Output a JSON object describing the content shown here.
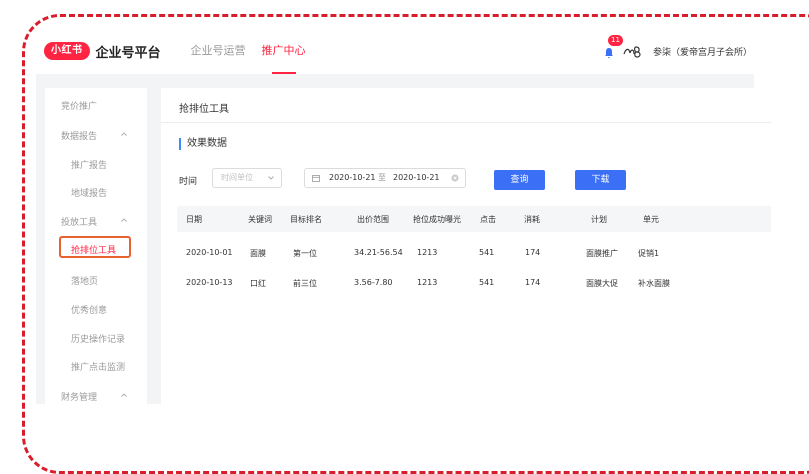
{
  "brand": {
    "badge": "小红书",
    "platform": "企业号平台"
  },
  "nav": {
    "tabs": [
      {
        "label": "企业号运营",
        "active": false
      },
      {
        "label": "推广中心",
        "active": true
      }
    ]
  },
  "top_right": {
    "notification_count": "11",
    "user": "参柒（爱帝宫月子会所）"
  },
  "sidebar": {
    "items": [
      {
        "label": "竞价推广"
      },
      {
        "label": "数据报告"
      },
      {
        "label": "推广报告"
      },
      {
        "label": "地域报告"
      },
      {
        "label": "投放工具"
      },
      {
        "label": "抢排位工具"
      },
      {
        "label": "落地页"
      },
      {
        "label": "优秀创意"
      },
      {
        "label": "历史操作记录"
      },
      {
        "label": "推广点击监测"
      },
      {
        "label": "财务管理"
      }
    ]
  },
  "main": {
    "page_title": "抢排位工具",
    "section_title": "效果数据",
    "filter": {
      "time_label": "时间",
      "unit_placeholder": "时间单位",
      "date_start": "2020-10-21",
      "date_sep": "至",
      "date_end": "2020-10-21",
      "query_button": "查询",
      "download_button": "下载"
    },
    "table": {
      "columns": [
        "日期",
        "关键词",
        "目标排名",
        "出价范围",
        "抢位成功曝光",
        "点击",
        "消耗",
        "计划",
        "单元"
      ],
      "rows": [
        [
          "2020-10-01",
          "面膜",
          "第一位",
          "34.21-56.54",
          "1213",
          "541",
          "174",
          "面膜推广",
          "促销1"
        ],
        [
          "2020-10-13",
          "口红",
          "前三位",
          "3.56-7.80",
          "1213",
          "541",
          "174",
          "面膜大促",
          "补水面膜"
        ]
      ]
    }
  },
  "colors": {
    "accent": "#ff2442",
    "primary_button": "#3b6ff5",
    "highlight_box": "#e8622f",
    "frame": "#d81e2b"
  }
}
